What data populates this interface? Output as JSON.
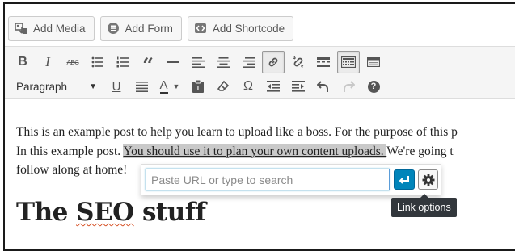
{
  "media_buttons": [
    {
      "label": "Add Media",
      "icon": "media-icon"
    },
    {
      "label": "Add Form",
      "icon": "form-icon"
    },
    {
      "label": "Add Shortcode",
      "icon": "shortcode-icon"
    }
  ],
  "toolbar": {
    "format_select_value": "Paragraph",
    "row1_icons": [
      "bold-icon",
      "italic-icon",
      "strikethrough-icon",
      "bulleted-list-icon",
      "numbered-list-icon",
      "blockquote-icon",
      "horizontal-rule-icon",
      "align-left-icon",
      "align-center-icon",
      "align-right-icon",
      "insert-link-icon",
      "remove-link-icon",
      "read-more-icon",
      "toolbar-toggle-icon",
      "distraction-free-icon"
    ],
    "row2_icons": [
      "underline-icon",
      "justify-icon",
      "text-color-icon",
      "paste-text-icon",
      "clear-formatting-icon",
      "special-character-icon",
      "outdent-icon",
      "indent-icon",
      "undo-icon",
      "redo-icon",
      "help-icon"
    ],
    "bold_glyph": "B",
    "italic_glyph": "I",
    "strike_glyph": "ABC",
    "quote_glyph": "“",
    "underline_glyph": "U",
    "text_color_glyph": "A",
    "omega_glyph": "Ω",
    "help_glyph": "?"
  },
  "content": {
    "line1": "This is an example post to help you learn to upload like a boss.  For the purpose of this p",
    "line2_before": "In this example post. ",
    "line2_selected": "You should use it to plan your own content uploads. ",
    "line2_after": "We're going t",
    "line3": "follow along at home!",
    "heading_before": "The ",
    "heading_misspelled": "SEO",
    "heading_after": " stuff"
  },
  "link_popup": {
    "placeholder": "Paste URL or type to search",
    "value": "",
    "tooltip": "Link options"
  },
  "colors": {
    "accent": "#0085ba",
    "selection": "#c9c9c9",
    "tooltip_bg": "#32373c",
    "toolbar_bg": "#f5f5f5"
  }
}
